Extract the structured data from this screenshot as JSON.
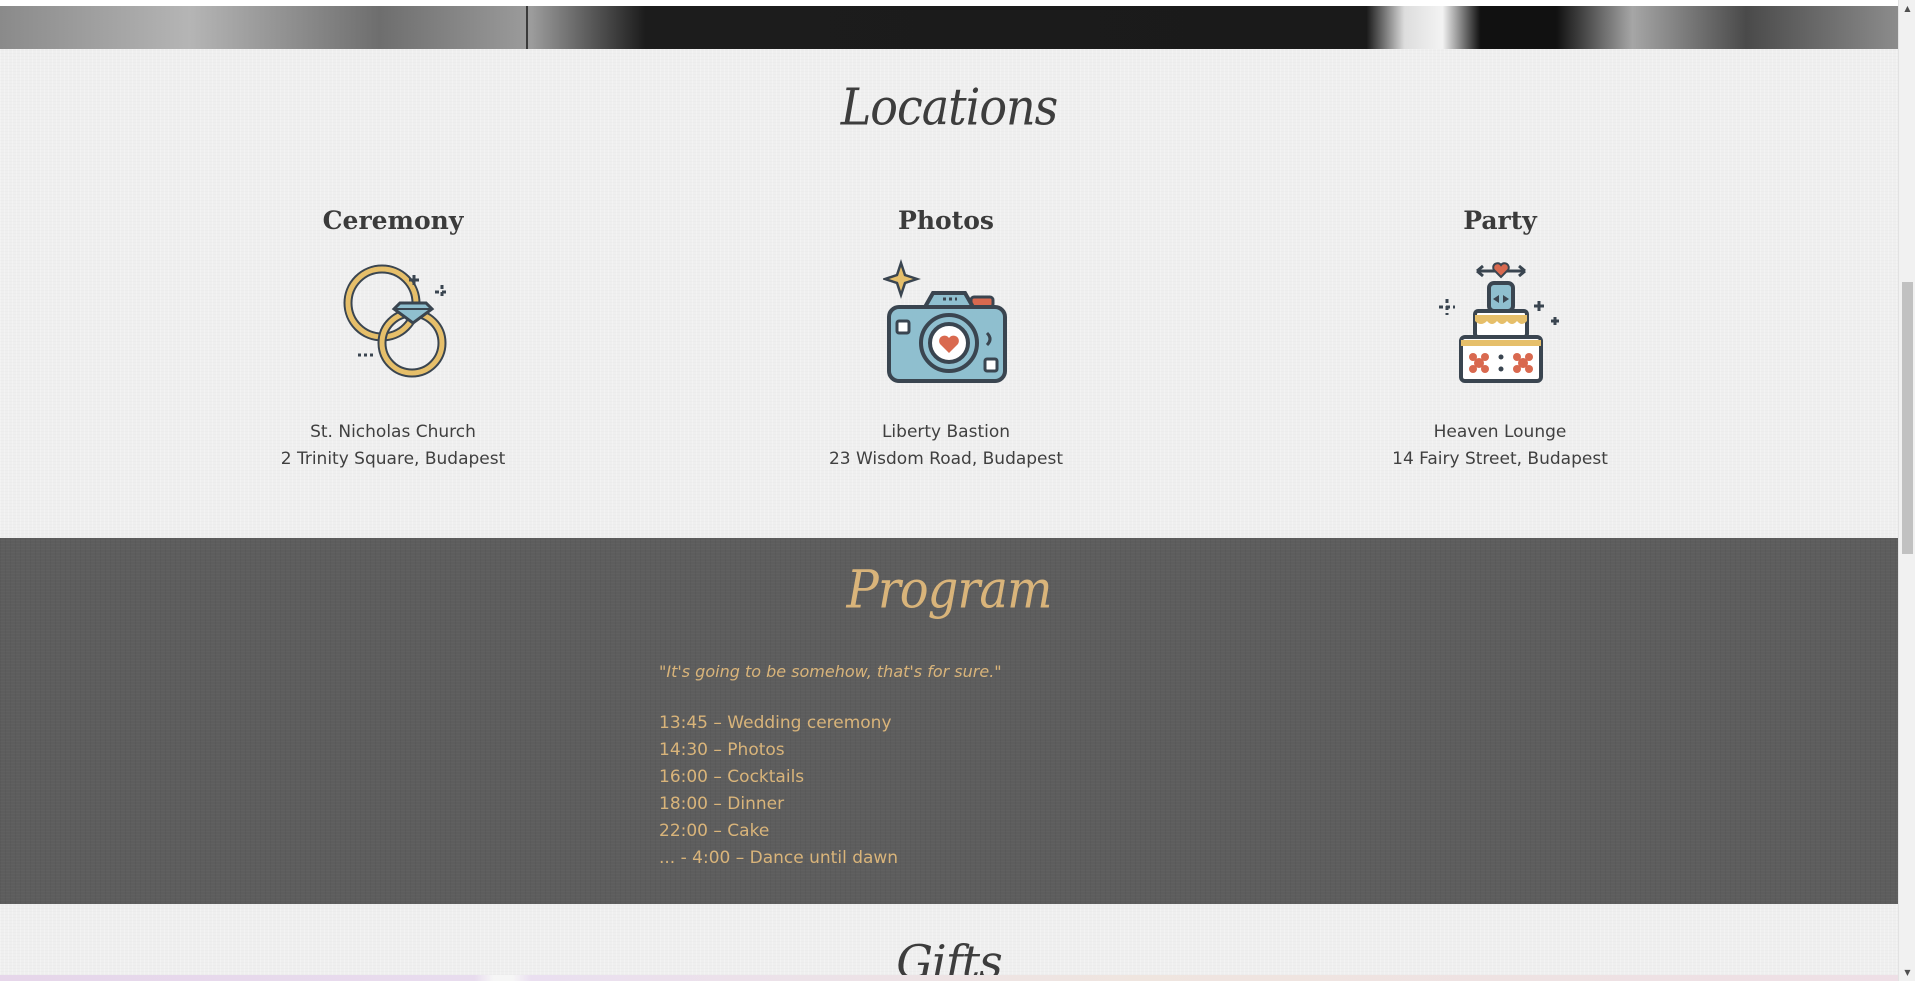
{
  "locations": {
    "title": "Locations",
    "items": [
      {
        "heading": "Ceremony",
        "icon": "rings-icon",
        "name": "St. Nicholas Church",
        "address": "2 Trinity Square, Budapest"
      },
      {
        "heading": "Photos",
        "icon": "camera-icon",
        "name": "Liberty Bastion",
        "address": "23 Wisdom Road, Budapest"
      },
      {
        "heading": "Party",
        "icon": "wedding-cake-icon",
        "name": "Heaven Lounge",
        "address": "14 Fairy Street, Budapest"
      }
    ]
  },
  "program": {
    "title": "Program",
    "quote": "\"It's going to be somehow, that's for sure.\"",
    "schedule": [
      "13:45 – Wedding ceremony",
      "14:30 – Photos",
      "16:00 – Cocktails",
      "18:00 – Dinner",
      "22:00 – Cake",
      "... - 4:00 – Dance until dawn"
    ]
  },
  "gifts": {
    "title": "Gifts"
  },
  "scrollbar": {
    "up_arrow": "▲",
    "down_arrow": "▼"
  },
  "colors": {
    "accent_gold": "#d9b47a",
    "program_bg": "#5d5d5d",
    "page_bg": "#efefef",
    "icon_stroke": "#3a4550",
    "icon_blue": "#8fbfcf",
    "icon_red": "#d9694f"
  }
}
